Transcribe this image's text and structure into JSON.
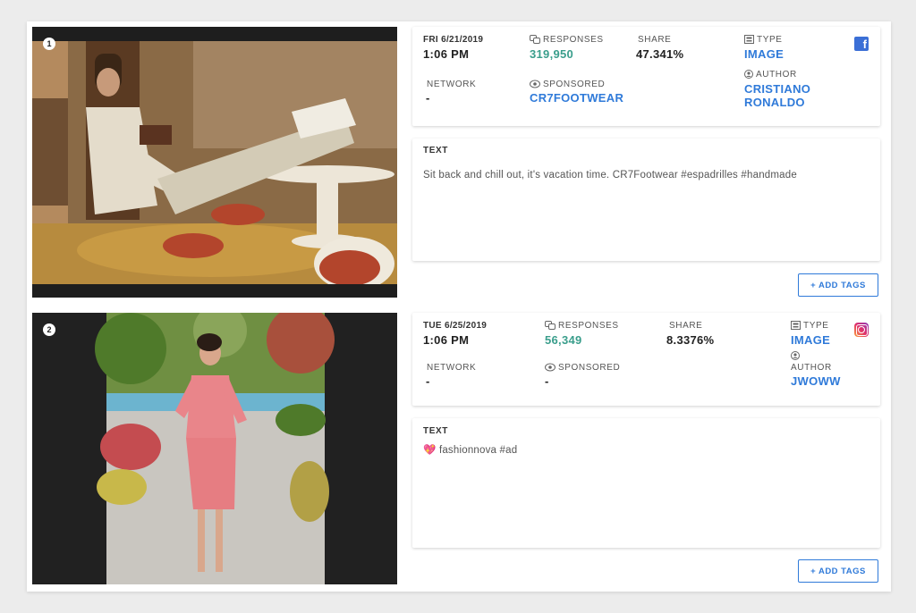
{
  "posts": [
    {
      "index": "1",
      "date": "FRI 6/21/2019",
      "time": "1:06 PM",
      "responses_label": "RESPONSES",
      "responses": "319,950",
      "share_label": "SHARE",
      "share": "47.341%",
      "type_label": "TYPE",
      "type": "IMAGE",
      "network_label": "NETWORK",
      "network": "-",
      "sponsored_label": "SPONSORED",
      "sponsored": "CR7FOOTWEAR",
      "author_label": "AUTHOR",
      "author_line1": "CRISTIANO",
      "author_line2": "RONALDO",
      "platform": "facebook-icon",
      "text_label": "TEXT",
      "text": "Sit back and chill out, it's vacation time. CR7Footwear #espadrilles #handmade",
      "add_tags": "+ ADD TAGS"
    },
    {
      "index": "2",
      "date": "TUE 6/25/2019",
      "time": "1:06 PM",
      "responses_label": "RESPONSES",
      "responses": "56,349",
      "share_label": "SHARE",
      "share": "8.3376%",
      "type_label": "TYPE",
      "type": "IMAGE",
      "network_label": "NETWORK",
      "network": "-",
      "sponsored_label": "SPONSORED",
      "sponsored": "-",
      "author_label": "AUTHOR",
      "author_line1": "JWOWW",
      "platform": "instagram-icon",
      "text_label": "TEXT",
      "text_emoji": "💖",
      "text": "fashionnova #ad",
      "add_tags": "+ ADD TAGS"
    }
  ],
  "colors": {
    "accent": "#2f7ad9",
    "responses": "#3a9e8c"
  }
}
